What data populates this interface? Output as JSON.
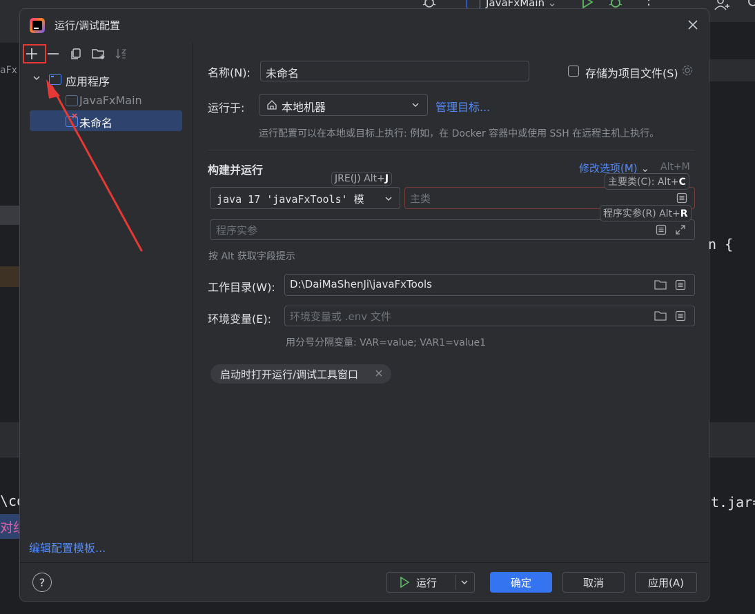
{
  "ide": {
    "run_config_name": "JavaFxMain",
    "left_fragment": "aFx",
    "code_brace": "n {",
    "terminal_left": "\\co",
    "terminal_left2": "对组",
    "terminal_right": "t.jar="
  },
  "dialog": {
    "title": "运行/调试配置",
    "tree": {
      "group_label": "应用程序",
      "items": [
        {
          "label": "JavaFxMain"
        },
        {
          "label": "未命名"
        }
      ]
    },
    "edit_templates_link": "编辑配置模板...",
    "form": {
      "name_label": "名称(N):",
      "name_value": "未命名",
      "store_as_file_label": "存储为项目文件(S)",
      "run_on_label": "运行于:",
      "run_on_value": "本地机器",
      "manage_targets_link": "管理目标...",
      "run_on_description": "运行配置可以在本地或目标上执行: 例如，在 Docker 容器中或使用 SSH 在远程主机上执行。",
      "build_run_heading": "构建并运行",
      "modify_options_link": "修改选项(M)",
      "modify_options_shortcut": "Alt+M",
      "jre_hint_label": "JRE(J) Alt+",
      "jre_hint_key": "J",
      "jre_value": "java 17 'javaFxTools' 模",
      "main_class_hint_label": "主要类(C): Alt+",
      "main_class_hint_key": "C",
      "main_class_placeholder": "主类",
      "program_args_hint_label": "程序实参(R) Alt+",
      "program_args_hint_key": "R",
      "program_args_placeholder": "程序实参",
      "alt_hint_text": "按 Alt 获取字段提示",
      "working_dir_label": "工作目录(W):",
      "working_dir_value": "D:\\DaiMaShenJi\\javaFxTools",
      "env_vars_label": "环境变量(E):",
      "env_vars_placeholder": "环境变量或 .env 文件",
      "env_vars_hint": "用分号分隔变量: VAR=value; VAR1=value1",
      "open_tool_window_chip": "启动时打开运行/调试工具窗口"
    },
    "buttons": {
      "run": "运行",
      "ok": "确定",
      "cancel": "取消",
      "apply": "应用(A)"
    }
  },
  "colors": {
    "accent": "#3574f0",
    "link": "#548af7",
    "annotation_red": "#e53935",
    "selection": "#2e436e"
  }
}
